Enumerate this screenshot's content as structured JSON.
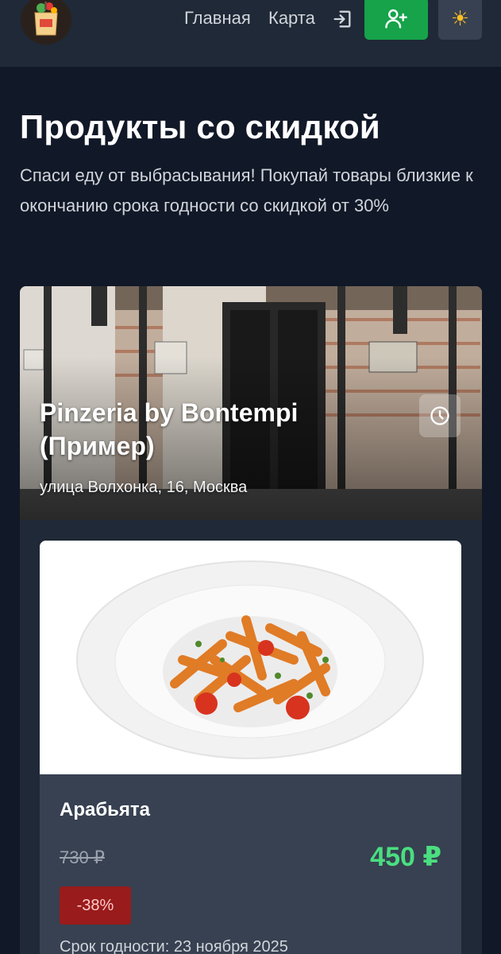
{
  "header": {
    "logo_icon": "grocery-bag-logo",
    "nav": [
      {
        "label": "Главная"
      },
      {
        "label": "Карта"
      }
    ],
    "login_icon": "login-icon",
    "register_icon": "user-plus-icon",
    "theme_icon": "sun-icon",
    "theme_glyph": "☀",
    "accent_color": "#16a34a"
  },
  "hero": {
    "title": "Продукты со скидкой",
    "subtitle": "Спаси еду от выбрасывания! Покупай товары близкие к окончанию срока годности со скидкой от 30%"
  },
  "store": {
    "name": "Pinzeria by Bontempi (Пример)",
    "address": "улица Волхонка, 16, Москва",
    "hours_icon": "clock-icon"
  },
  "product": {
    "name": "Арабьята",
    "old_price": "730 ₽",
    "new_price": "450 ₽",
    "discount": "-38%",
    "expiry": "Срок годности: 23 ноября 2025",
    "price_color": "#4ade80",
    "badge_color": "#991b1b"
  }
}
